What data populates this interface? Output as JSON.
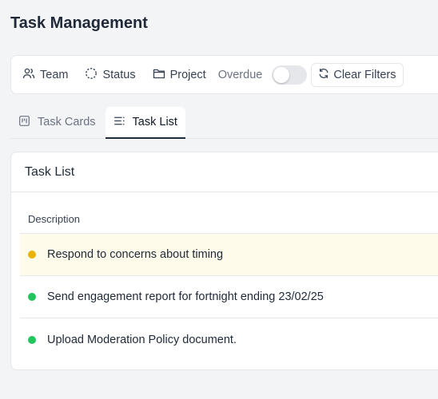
{
  "page": {
    "title": "Task Management"
  },
  "filters": {
    "team_label": "Team",
    "status_label": "Status",
    "project_label": "Project",
    "overdue_label": "Overdue",
    "overdue_on": false,
    "clear_label": "Clear Filters"
  },
  "tabs": [
    {
      "label": "Task Cards",
      "icon": "kanban-icon",
      "active": false
    },
    {
      "label": "Task List",
      "icon": "list-icon",
      "active": true
    }
  ],
  "task_list": {
    "title": "Task List",
    "column_header": "Description",
    "rows": [
      {
        "description": "Respond to concerns about timing",
        "status_color": "#eab308",
        "highlighted": true
      },
      {
        "description": "Send engagement report for fortnight ending 23/02/25",
        "status_color": "#22c55e",
        "highlighted": false
      },
      {
        "description": "Upload Moderation Policy document.",
        "status_color": "#22c55e",
        "highlighted": false
      }
    ]
  }
}
